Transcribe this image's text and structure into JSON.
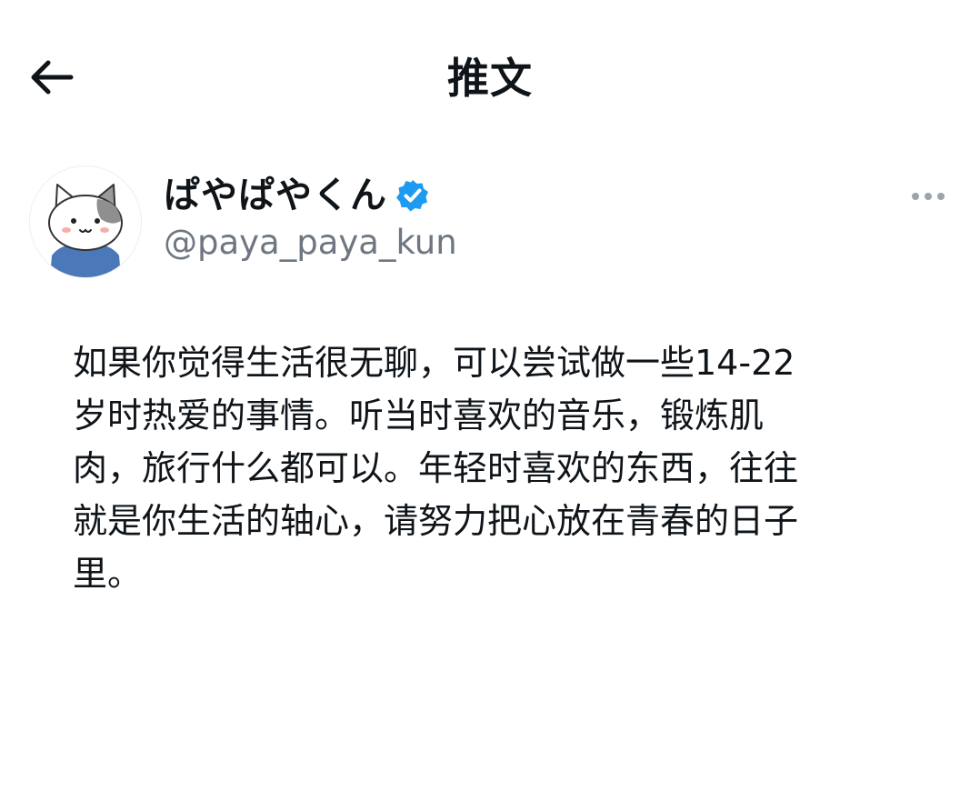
{
  "header": {
    "title": "推文",
    "back_icon": "arrow-left-icon"
  },
  "author": {
    "display_name": "ぱやぱやくん",
    "handle": "@paya_paya_kun",
    "verified_icon": "verified-badge-icon",
    "verified_color": "#1d9bf0",
    "avatar_icon": "cat-avatar-icon",
    "more_icon": "more-dots-icon"
  },
  "tweet": {
    "text": "如果你觉得生活很无聊，可以尝试做一些14-22\n岁时热爱的事情。听当时喜欢的音乐，锻炼肌\n肉，旅行什么都可以。年轻时喜欢的东西，往往\n就是你生活的轴心，请努力把心放在青春的日子\n里。"
  }
}
